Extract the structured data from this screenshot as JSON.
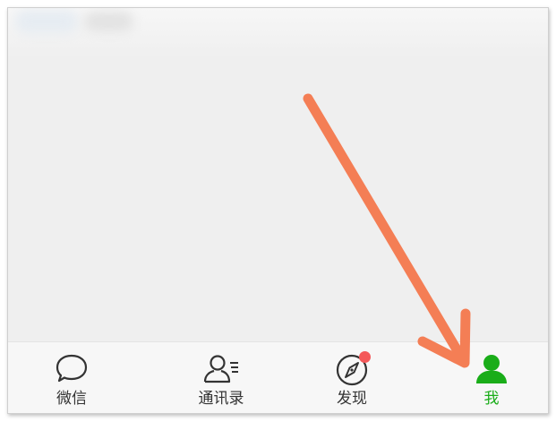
{
  "tab_bar": {
    "tabs": [
      {
        "label": "微信",
        "icon": "chat-bubble-icon",
        "active": false
      },
      {
        "label": "通讯录",
        "icon": "contacts-icon",
        "active": false
      },
      {
        "label": "发现",
        "icon": "compass-icon",
        "active": false,
        "badge": "red-dot"
      },
      {
        "label": "我",
        "icon": "person-icon",
        "active": true
      }
    ]
  },
  "colors": {
    "active": "#1aad19",
    "inactive": "#333333",
    "badge": "#f4595a",
    "annotation_arrow": "#f47e55"
  }
}
